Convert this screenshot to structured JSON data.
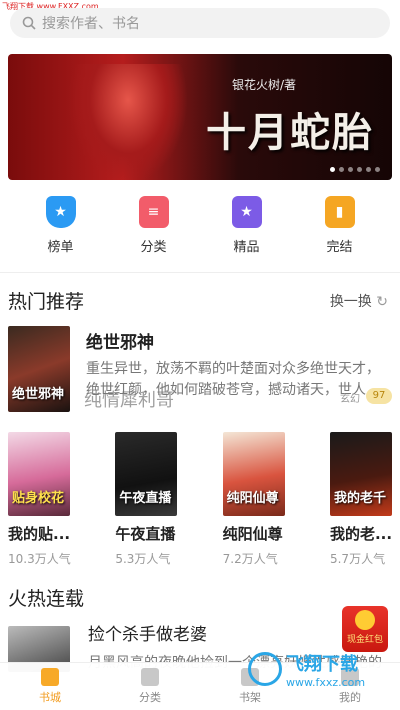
{
  "watermark_top": "飞翔下载 www.FXXZ.com",
  "search": {
    "placeholder": "搜索作者、书名"
  },
  "banner": {
    "author": "银花火树/著",
    "title": "十月蛇胎",
    "dots": 6,
    "active_dot": 1
  },
  "categories": [
    {
      "label": "榜单",
      "icon": "trophy-icon",
      "color": "#2b9af3"
    },
    {
      "label": "分类",
      "icon": "category-icon",
      "color": "#f25c6a"
    },
    {
      "label": "精品",
      "icon": "star-icon",
      "color": "#7c5be6"
    },
    {
      "label": "完结",
      "icon": "book-done-icon",
      "color": "#f5a623"
    }
  ],
  "hot": {
    "title": "热门推荐",
    "refresh": "换一换",
    "featured": {
      "cover_text": "绝世邪神",
      "name": "绝世邪神",
      "desc": "重生异世，放荡不羁的叶楚面对众多绝世天才，绝世红颜，他如何踏破苍穹，撼动诸天，世人",
      "tag": "玄幻",
      "badge": "97"
    },
    "books": [
      {
        "cover_text": "贴身校花",
        "title": "我的贴...",
        "popularity": "10.3万人气"
      },
      {
        "cover_text": "午夜直播",
        "title": "午夜直播",
        "popularity": "5.3万人气"
      },
      {
        "cover_text": "纯阳仙尊",
        "title": "纯阳仙尊",
        "popularity": "7.2万人气"
      },
      {
        "cover_text": "我的老千",
        "title": "我的老...",
        "popularity": "5.7万人气"
      }
    ]
  },
  "watermark_mid": "纯情犀利哥",
  "serial": {
    "title": "火热连载",
    "book": {
      "name": "捡个杀手做老婆",
      "desc": "月黑风高的夜晚他捡到一个漂亮妖媚性感妖艳的"
    }
  },
  "promo": {
    "label": "现金红包"
  },
  "tabs": [
    {
      "label": "书城",
      "active": true
    },
    {
      "label": "分类",
      "active": false
    },
    {
      "label": "书架",
      "active": false
    },
    {
      "label": "我的",
      "active": false
    }
  ],
  "watermark_br": {
    "brand": "飞翔下载",
    "url": "www.fxxz.com"
  }
}
